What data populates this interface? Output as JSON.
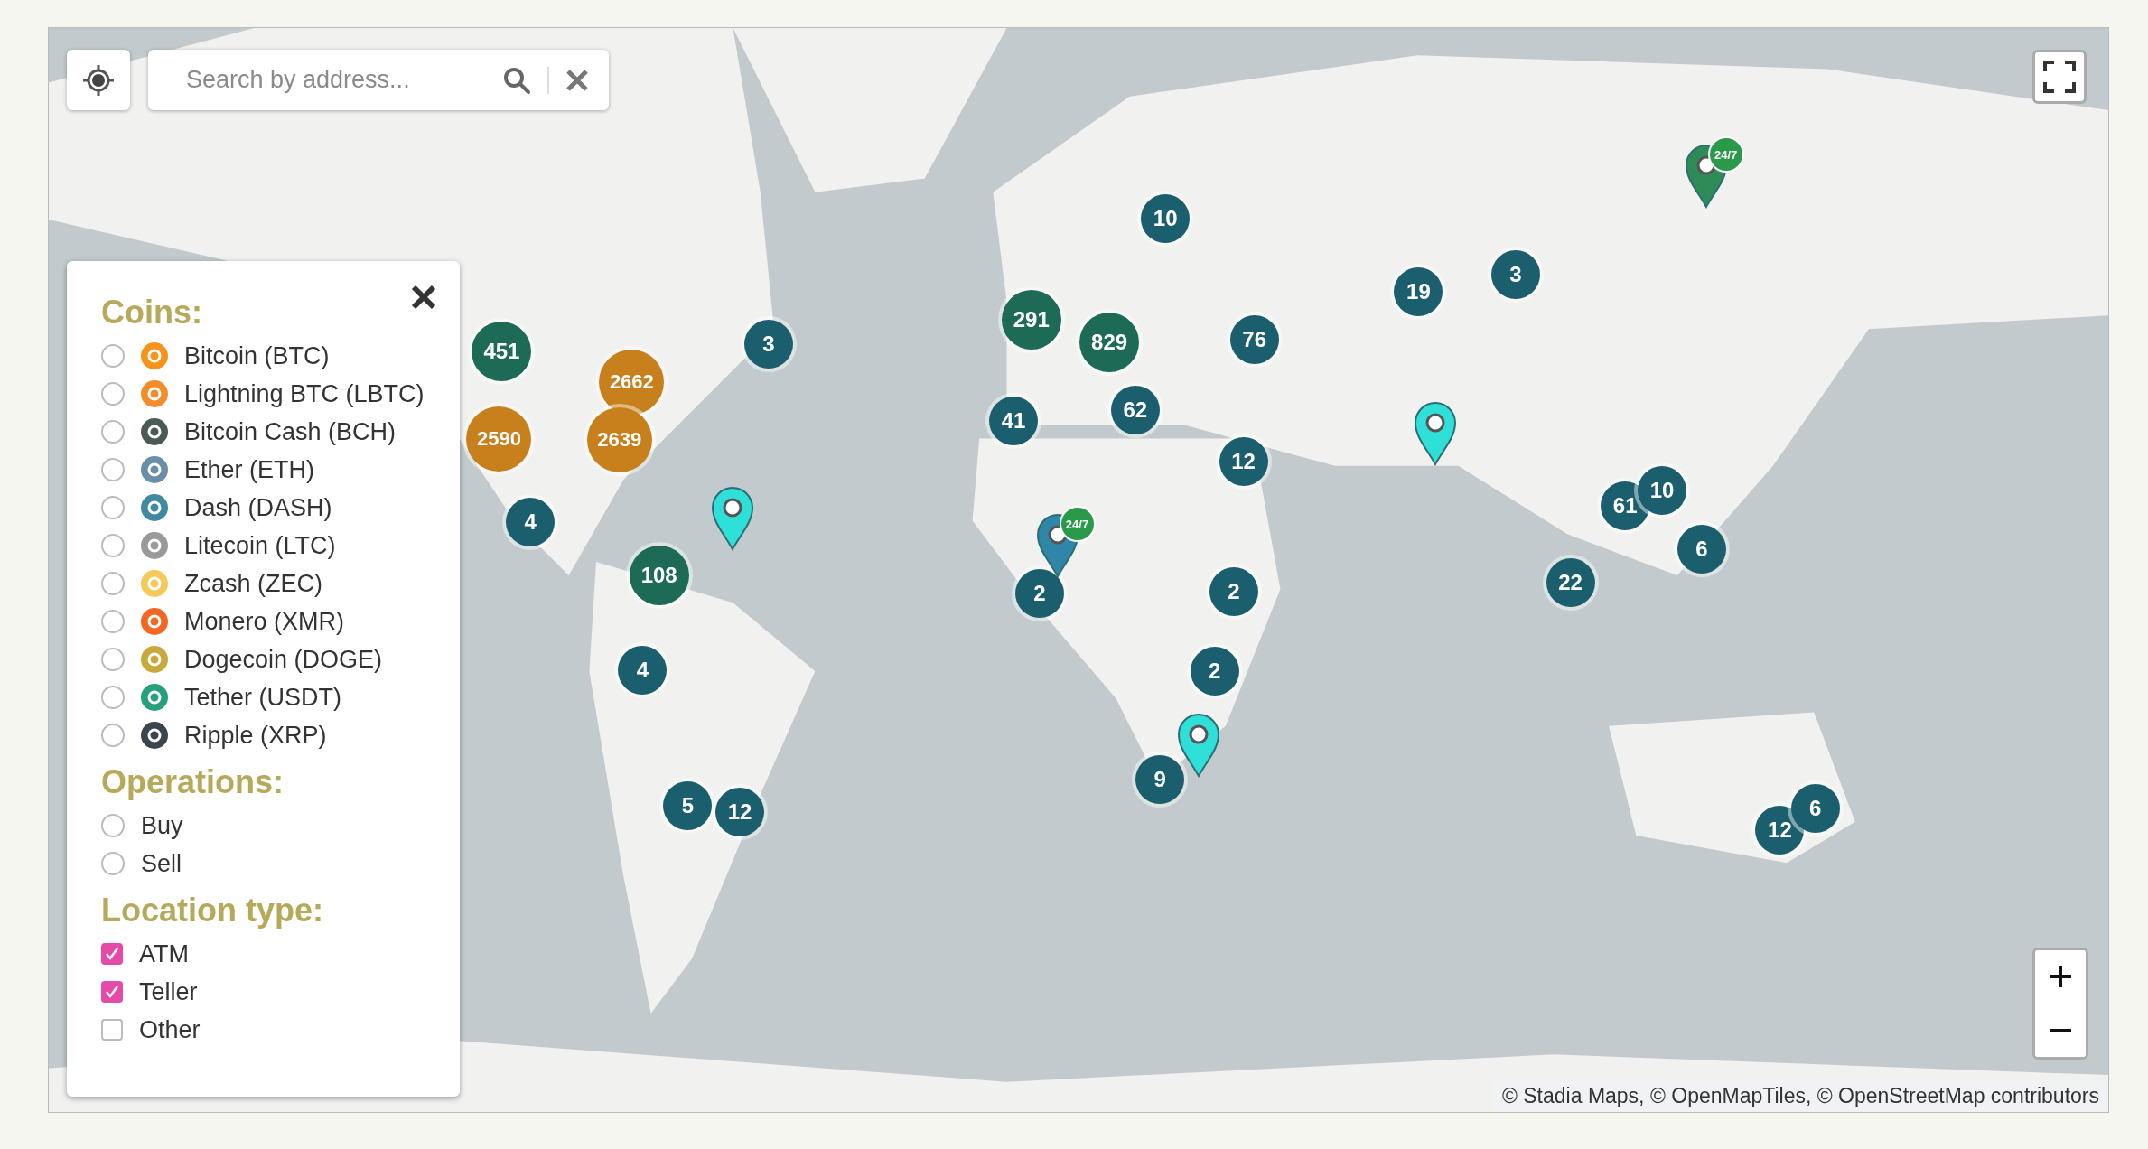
{
  "search": {
    "placeholder": "Search by address..."
  },
  "filter_panel": {
    "sections": [
      {
        "title": "Coins:",
        "kind": "radio",
        "items": [
          {
            "label": "Bitcoin (BTC)",
            "color": "#f7931a",
            "selected": false
          },
          {
            "label": "Lightning BTC (LBTC)",
            "color": "#f58c2a",
            "selected": false
          },
          {
            "label": "Bitcoin Cash (BCH)",
            "color": "#4a5a55",
            "selected": false
          },
          {
            "label": "Ether (ETH)",
            "color": "#6b8ea8",
            "selected": false
          },
          {
            "label": "Dash (DASH)",
            "color": "#3f8aa0",
            "selected": false
          },
          {
            "label": "Litecoin (LTC)",
            "color": "#9a9a9a",
            "selected": false
          },
          {
            "label": "Zcash (ZEC)",
            "color": "#f5c95a",
            "selected": false
          },
          {
            "label": "Monero (XMR)",
            "color": "#f26822",
            "selected": false
          },
          {
            "label": "Dogecoin (DOGE)",
            "color": "#c9a93c",
            "selected": false
          },
          {
            "label": "Tether (USDT)",
            "color": "#26a17b",
            "selected": false
          },
          {
            "label": "Ripple (XRP)",
            "color": "#3a4550",
            "selected": false
          }
        ]
      },
      {
        "title": "Operations:",
        "kind": "radio",
        "items": [
          {
            "label": "Buy",
            "selected": false
          },
          {
            "label": "Sell",
            "selected": false
          }
        ]
      },
      {
        "title": "Location type:",
        "kind": "checkbox",
        "items": [
          {
            "label": "ATM",
            "checked": true
          },
          {
            "label": "Teller",
            "checked": true
          },
          {
            "label": "Other",
            "checked": false
          }
        ]
      }
    ]
  },
  "clusters": [
    {
      "count": "451",
      "color": "#1d6b57"
    },
    {
      "count": "2662",
      "color": "#c8801c"
    },
    {
      "count": "2590",
      "color": "#c8801c"
    },
    {
      "count": "2639",
      "color": "#c8801c"
    },
    {
      "count": "3",
      "color": "#1b5e6e"
    },
    {
      "count": "4",
      "color": "#1b5e6e"
    },
    {
      "count": "108",
      "color": "#1d6b57"
    },
    {
      "count": "4",
      "color": "#1b5e6e"
    },
    {
      "count": "5",
      "color": "#1b5e6e"
    },
    {
      "count": "12",
      "color": "#1b5e6e"
    },
    {
      "count": "291",
      "color": "#1d6b57"
    },
    {
      "count": "829",
      "color": "#1d6b57"
    },
    {
      "count": "76",
      "color": "#1b5e6e"
    },
    {
      "count": "10",
      "color": "#1b5e6e"
    },
    {
      "count": "41",
      "color": "#1b5e6e"
    },
    {
      "count": "62",
      "color": "#1b5e6e"
    },
    {
      "count": "12",
      "color": "#1b5e6e"
    },
    {
      "count": "2",
      "color": "#1b5e6e"
    },
    {
      "count": "2",
      "color": "#1b5e6e"
    },
    {
      "count": "2",
      "color": "#1b5e6e"
    },
    {
      "count": "9",
      "color": "#1b5e6e"
    },
    {
      "count": "19",
      "color": "#1b5e6e"
    },
    {
      "count": "3",
      "color": "#1b5e6e"
    },
    {
      "count": "61",
      "color": "#1b5e6e"
    },
    {
      "count": "10",
      "color": "#1b5e6e"
    },
    {
      "count": "6",
      "color": "#1b5e6e"
    },
    {
      "count": "22",
      "color": "#1b5e6e"
    },
    {
      "count": "12",
      "color": "#1b5e6e"
    },
    {
      "count": "6",
      "color": "#1b5e6e"
    }
  ],
  "pins": [
    {
      "color": "#2fe0d8"
    },
    {
      "color": "#2fe0d8"
    },
    {
      "color": "#2fe0d8"
    },
    {
      "color": "#2f86a8",
      "badge": "24/7"
    },
    {
      "color": "#2e8b57",
      "badge": "24/7"
    }
  ],
  "attribution": "© Stadia Maps, © OpenMapTiles, © OpenStreetMap contributors"
}
